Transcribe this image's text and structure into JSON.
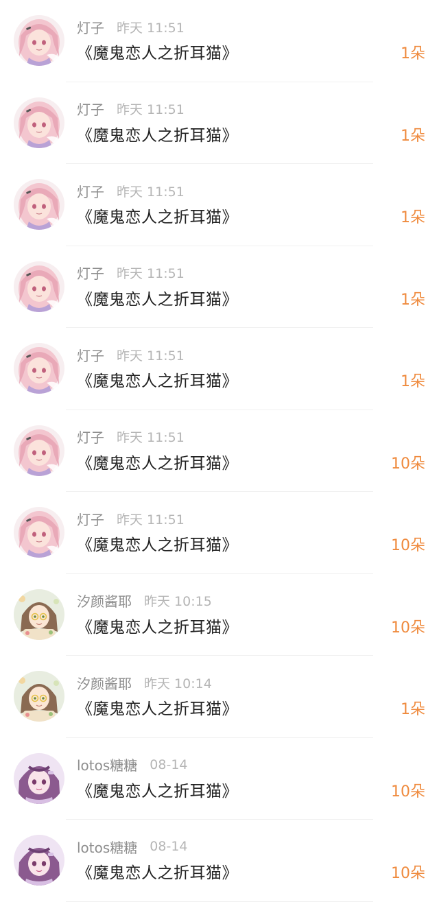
{
  "colors": {
    "accent": "#ef8a3d",
    "name_text": "#8e8e8e",
    "time_text": "#b5b5b5",
    "title_text": "#222222",
    "divider": "#f0f0f0"
  },
  "rows": [
    {
      "avatar": "pink-anime-girl-avatar",
      "name": "灯子",
      "time": "昨天 11:51",
      "title": "《魔鬼恋人之折耳猫》",
      "count": "1朵"
    },
    {
      "avatar": "pink-anime-girl-avatar",
      "name": "灯子",
      "time": "昨天 11:51",
      "title": "《魔鬼恋人之折耳猫》",
      "count": "1朵"
    },
    {
      "avatar": "pink-anime-girl-avatar",
      "name": "灯子",
      "time": "昨天 11:51",
      "title": "《魔鬼恋人之折耳猫》",
      "count": "1朵"
    },
    {
      "avatar": "pink-anime-girl-avatar",
      "name": "灯子",
      "time": "昨天 11:51",
      "title": "《魔鬼恋人之折耳猫》",
      "count": "1朵"
    },
    {
      "avatar": "pink-anime-girl-avatar",
      "name": "灯子",
      "time": "昨天 11:51",
      "title": "《魔鬼恋人之折耳猫》",
      "count": "1朵"
    },
    {
      "avatar": "pink-anime-girl-avatar",
      "name": "灯子",
      "time": "昨天 11:51",
      "title": "《魔鬼恋人之折耳猫》",
      "count": "10朵"
    },
    {
      "avatar": "pink-anime-girl-avatar",
      "name": "灯子",
      "time": "昨天 11:51",
      "title": "《魔鬼恋人之折耳猫》",
      "count": "10朵"
    },
    {
      "avatar": "brown-hair-glasses-girl-avatar",
      "name": "汐颜酱耶",
      "time": "昨天 10:15",
      "title": "《魔鬼恋人之折耳猫》",
      "count": "10朵"
    },
    {
      "avatar": "brown-hair-glasses-girl-avatar",
      "name": "汐颜酱耶",
      "time": "昨天 10:14",
      "title": "《魔鬼恋人之折耳猫》",
      "count": "1朵"
    },
    {
      "avatar": "purple-anime-girl-avatar",
      "name": "lotos糖糖",
      "time": "08-14",
      "title": "《魔鬼恋人之折耳猫》",
      "count": "10朵"
    },
    {
      "avatar": "purple-anime-girl-avatar",
      "name": "lotos糖糖",
      "time": "08-14",
      "title": "《魔鬼恋人之折耳猫》",
      "count": "10朵"
    }
  ]
}
